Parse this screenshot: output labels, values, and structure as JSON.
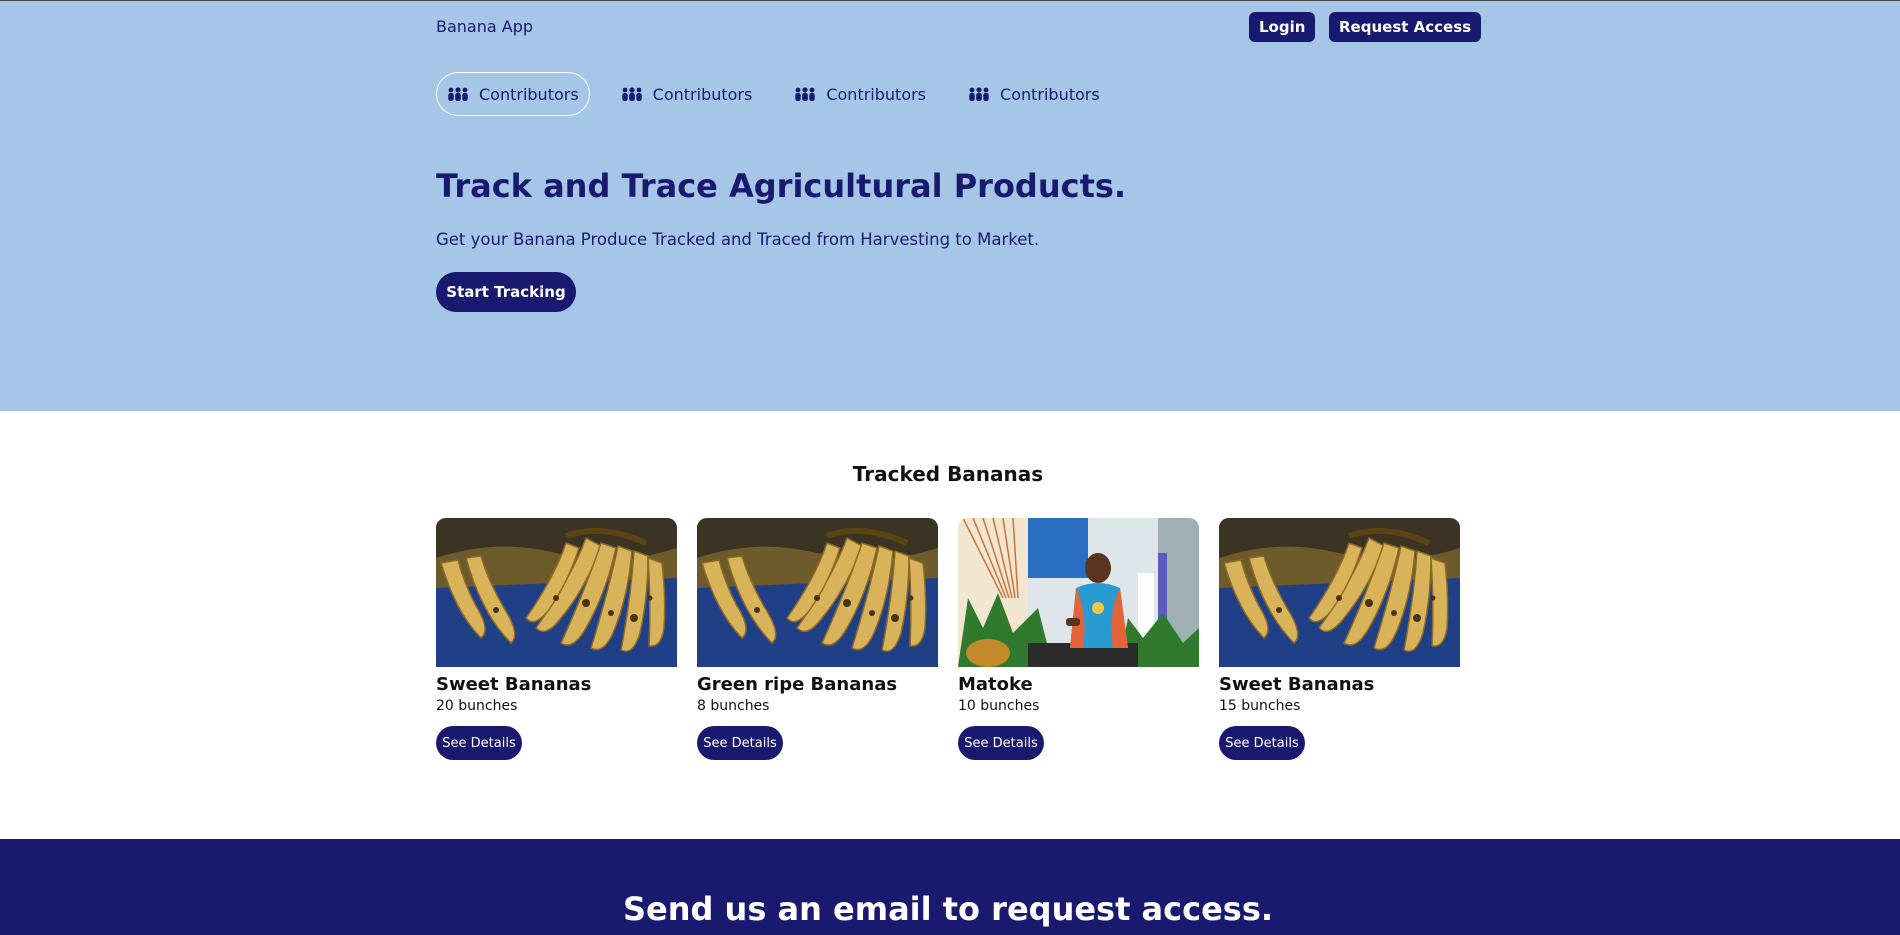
{
  "header": {
    "brand": "Banana App",
    "login_label": "Login",
    "request_access_label": "Request Access"
  },
  "nav": {
    "items": [
      {
        "label": "Contributors",
        "icon": "people-icon",
        "active": true
      },
      {
        "label": "Contributors",
        "icon": "people-icon"
      },
      {
        "label": "Contributors",
        "icon": "people-icon"
      },
      {
        "label": "Contributors",
        "icon": "people-icon"
      }
    ]
  },
  "hero": {
    "title": "Track and Trace Agricultural Products.",
    "subtitle": "Get your Banana Produce Tracked and Traced from Harvesting to Market.",
    "cta_label": "Start Tracking"
  },
  "tracked": {
    "title": "Tracked Bananas",
    "cards": [
      {
        "name": "Sweet Bananas",
        "quantity": "20 bunches",
        "button": "See Details",
        "image": "bananas-photo"
      },
      {
        "name": "Green ripe Bananas",
        "quantity": "8 bunches",
        "button": "See Details",
        "image": "bananas-photo"
      },
      {
        "name": "Matoke",
        "quantity": "10 bunches",
        "button": "See Details",
        "image": "vendor-photo"
      },
      {
        "name": "Sweet Bananas",
        "quantity": "15 bunches",
        "button": "See Details",
        "image": "bananas-photo"
      }
    ]
  },
  "footer": {
    "title": "Send us an email to request access."
  },
  "colors": {
    "hero_bg": "#a5c6e6",
    "primary": "#191970",
    "text_dark": "#111111"
  }
}
